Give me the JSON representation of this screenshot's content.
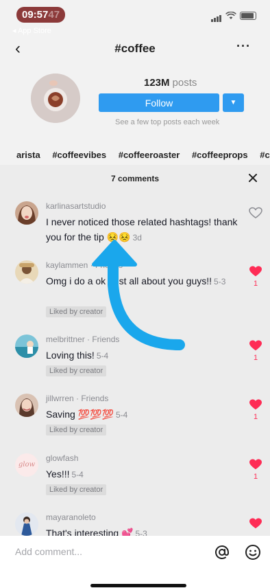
{
  "status_bar": {
    "time": "09:57",
    "time_suffix": "47",
    "back_app": "◂ App Store"
  },
  "nav": {
    "back_icon": "chevron-left-icon",
    "title": "#coffee",
    "more_icon": "ellipsis-icon"
  },
  "hashtag": {
    "posts_count": "123M",
    "posts_word": "posts",
    "follow_label": "Follow",
    "subtitle": "See a few top posts each week",
    "related_tags": [
      "arista",
      "#coffeevibes",
      "#coffeeroaster",
      "#coffeeprops",
      "#c"
    ]
  },
  "comments_sheet": {
    "title": "7 comments",
    "comments": [
      {
        "username": "karlinasartstudio",
        "text": "I never noticed those related hashtags! thank you for the tip 😣😣",
        "time": "3d",
        "liked_by_creator": "",
        "liked": false,
        "likes": ""
      },
      {
        "username": "kaylammen · Friends",
        "text": "Omg i do a ok post all about you guys!!",
        "time": "5-3",
        "liked_by_creator": "Liked by creator",
        "liked": true,
        "likes": "1"
      },
      {
        "username": "melbrittner · Friends",
        "text": "Loving this!",
        "time": "5-4",
        "liked_by_creator": "Liked by creator",
        "liked": true,
        "likes": "1"
      },
      {
        "username": "jillwrren · Friends",
        "text": "Saving 💯💯💯",
        "time": "5-4",
        "liked_by_creator": "Liked by creator",
        "liked": true,
        "likes": "1"
      },
      {
        "username": "glowfash",
        "text": "Yes!!!",
        "time": "5-4",
        "liked_by_creator": "Liked by creator",
        "liked": true,
        "likes": "1"
      },
      {
        "username": "mayaranoleto",
        "text": "That's interesting 💕",
        "time": "5-3",
        "liked_by_creator": "",
        "liked": true,
        "likes": ""
      }
    ],
    "glowfash_avatar_text": "glow"
  },
  "input_bar": {
    "placeholder": "Add comment...",
    "mention_icon": "at-icon",
    "emoji_icon": "emoji-icon"
  },
  "colors": {
    "like_red": "#fe2c55",
    "follow_blue": "#2f9bf0",
    "arrow_blue": "#1aa7ec",
    "sheet_bg": "#ececec"
  }
}
